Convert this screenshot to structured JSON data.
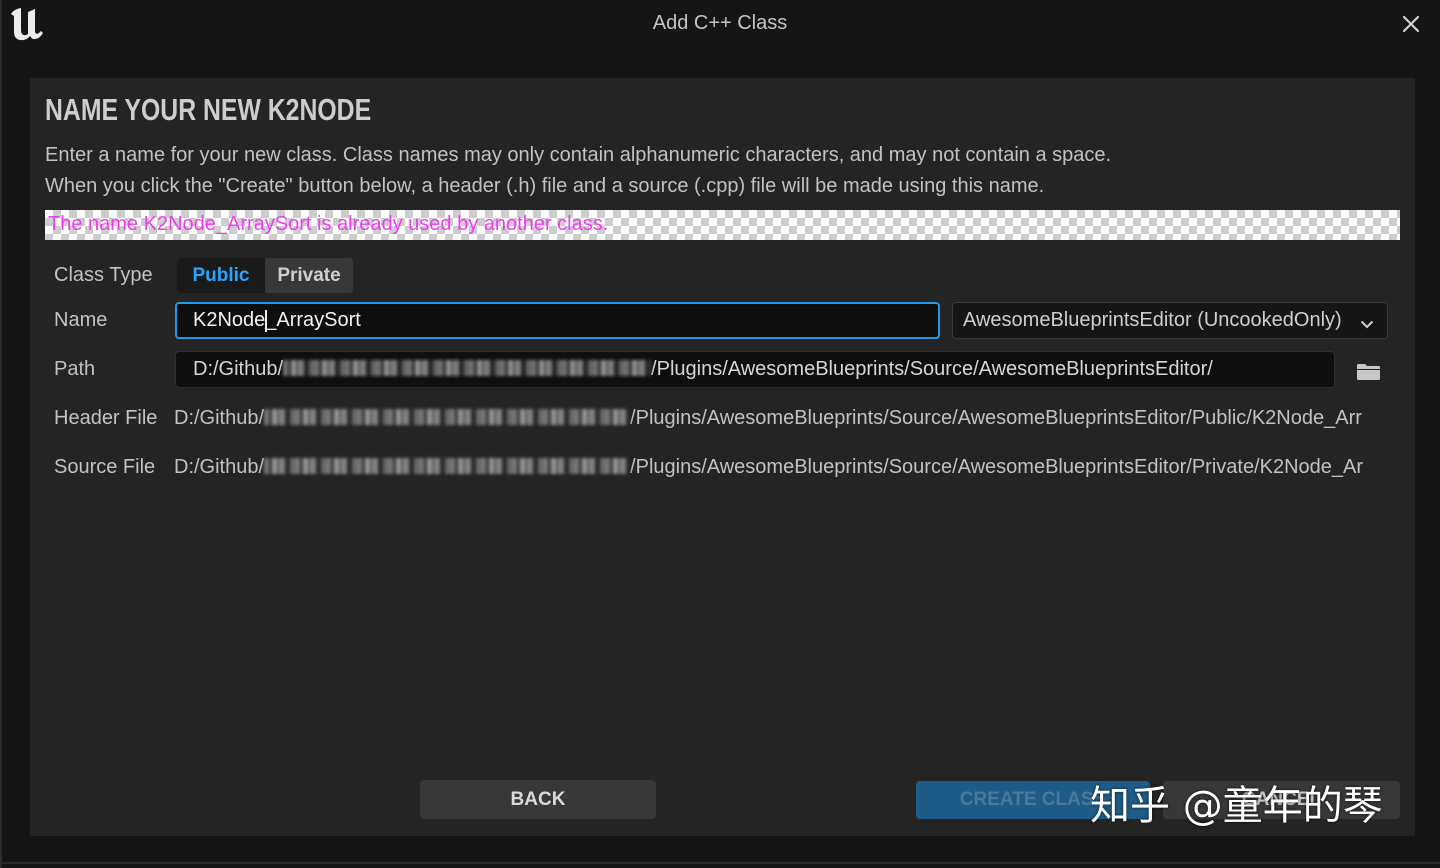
{
  "window": {
    "title": "Add C++ Class",
    "logo_icon": "unreal-engine-logo-icon",
    "close_icon": "close-icon"
  },
  "page": {
    "heading": "NAME YOUR NEW K2NODE",
    "description": [
      "Enter a name for your new class. Class names may only contain alphanumeric characters, and may not contain a space.",
      "When you click the \"Create\" button below, a header (.h) file and a source (.cpp) file will be made using this name."
    ],
    "error": "The name K2Node_ArraySort is already used by another class."
  },
  "form": {
    "class_type": {
      "label": "Class Type",
      "options": [
        "Public",
        "Private"
      ],
      "selected_index": 0
    },
    "name": {
      "label": "Name",
      "value": "K2Node_ArraySort"
    },
    "module": {
      "value": "AwesomeBlueprintsEditor (UncookedOnly)",
      "icon": "chevron-down-icon"
    },
    "path": {
      "label": "Path",
      "prefix": "D:/Github/",
      "suffix": "/Plugins/AwesomeBlueprints/Source/AwesomeBlueprintsEditor/",
      "browse_icon": "folder-icon"
    },
    "header_file": {
      "label": "Header File",
      "prefix": "D:/Github/",
      "suffix": "/Plugins/AwesomeBlueprints/Source/AwesomeBlueprintsEditor/Public/K2Node_Arr"
    },
    "source_file": {
      "label": "Source File",
      "prefix": "D:/Github/",
      "suffix": "/Plugins/AwesomeBlueprints/Source/AwesomeBlueprintsEditor/Private/K2Node_Ar"
    }
  },
  "buttons": {
    "back": "BACK",
    "create": "CREATE CLASS",
    "cancel": "CANCEL"
  },
  "watermark": "知乎 @童年的琴",
  "colors": {
    "accent": "#26a6ff",
    "error_text": "#f03cf0",
    "create_button": "#1d5c88"
  }
}
